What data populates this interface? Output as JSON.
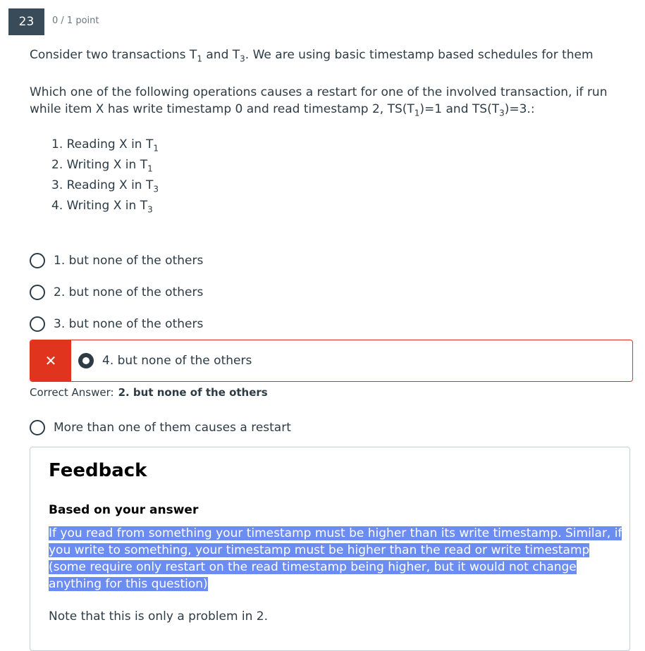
{
  "question": {
    "number": "23",
    "points": "0 / 1 point",
    "intro_a": "Consider two transactions T",
    "intro_sub1": "1",
    "intro_b": " and T",
    "intro_sub2": "3",
    "intro_c": ". We are using basic timestamp based schedules for them",
    "prompt_a": "Which one of the following operations causes a restart for one of the involved transaction, if run while item X has write timestamp 0 and read timestamp 2, TS(T",
    "prompt_sub1": "1",
    "prompt_b": ")=1 and TS(T",
    "prompt_sub2": "3",
    "prompt_c": ")=3.:",
    "ops": [
      {
        "text": "1. Reading X in T",
        "sub": "1"
      },
      {
        "text": "2. Writing X in T",
        "sub": "1"
      },
      {
        "text": "3. Reading X in T",
        "sub": "3"
      },
      {
        "text": "4. Writing X in T",
        "sub": "3"
      }
    ]
  },
  "answers": [
    {
      "label": "1. but none of the others",
      "selected": false
    },
    {
      "label": "2. but none of the others",
      "selected": false
    },
    {
      "label": "3. but none of the others",
      "selected": false
    },
    {
      "label": "4. but none of the others",
      "selected": true,
      "status": "incorrect"
    },
    {
      "label": "More than one of them causes a restart",
      "selected": false
    }
  ],
  "wrong_mark": "✕",
  "correct_answer": {
    "prefix": "Correct Answer:",
    "value": "2. but none of the others"
  },
  "feedback": {
    "title": "Feedback",
    "subtitle": "Based on your answer",
    "body": "If you read from something your timestamp must be higher than its write timestamp. Similar, if you write to something, your timestamp must be higher than the read or write timestamp (some require only restart on the read timestamp being higher, but it would not change anything for this question)",
    "note": "Note that this is only a problem in 2."
  },
  "colors": {
    "incorrect": "#e0341f",
    "badge": "#394b58",
    "highlight": "#6b8cf0"
  }
}
